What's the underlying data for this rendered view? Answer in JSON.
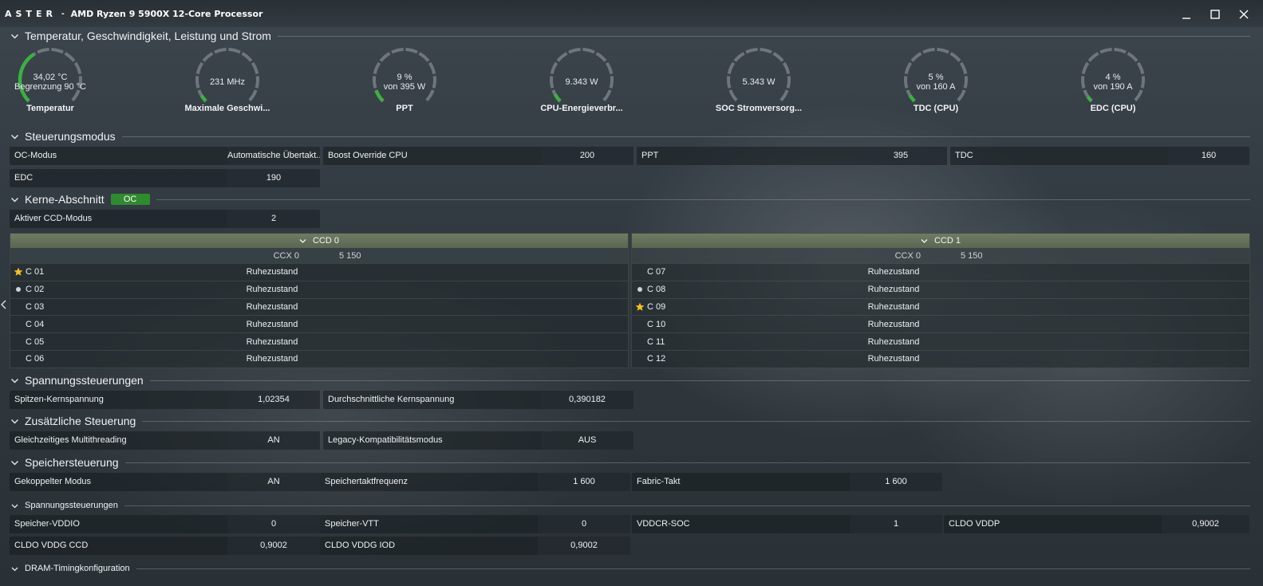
{
  "titlebar": {
    "brand": "ASTER",
    "separator": "-",
    "title": "AMD Ryzen 9 5900X 12-Core Processor"
  },
  "sections": {
    "temp": "Temperatur, Geschwindigkeit, Leistung und Strom",
    "control_mode": "Steuerungsmodus",
    "cores": "Kerne-Abschnitt",
    "cores_badge": "OC",
    "voltage": "Spannungssteuerungen",
    "extra": "Zusätzliche Steuerung",
    "memory": "Speichersteuerung",
    "mem_voltage": "Spannungssteuerungen",
    "dram_timing": "DRAM-Timingkonfiguration"
  },
  "gauges": [
    {
      "value": "34,02 °C",
      "sub": "Begrenzung 90 °C",
      "label": "Temperatur",
      "fill": 0.378
    },
    {
      "value": "231  MHz",
      "sub": "",
      "label": "Maximale Geschwi...",
      "fill": 0.05
    },
    {
      "value": "9 %",
      "sub": "von 395 W",
      "label": "PPT",
      "fill": 0.09
    },
    {
      "value": "9.343 W",
      "sub": "",
      "label": "CPU-Energieverbr...",
      "fill": 0.06
    },
    {
      "value": "5.343 W",
      "sub": "",
      "label": "SOC Stromversorg...",
      "fill": 0.0
    },
    {
      "value": "5 %",
      "sub": "von 160 A",
      "label": "TDC (CPU)",
      "fill": 0.05
    },
    {
      "value": "4 %",
      "sub": "von 190 A",
      "label": "EDC (CPU)",
      "fill": 0.04
    }
  ],
  "control": {
    "oc_mode": {
      "label": "OC-Modus",
      "value": "Automatische Übertakt..."
    },
    "boost": {
      "label": "Boost Override CPU",
      "value": "200"
    },
    "ppt": {
      "label": "PPT",
      "value": "395"
    },
    "tdc": {
      "label": "TDC",
      "value": "160"
    },
    "edc": {
      "label": "EDC",
      "value": "190"
    }
  },
  "cores": {
    "active_ccd": {
      "label": "Aktiver CCD-Modus",
      "value": "2"
    },
    "ccd0": {
      "title": "CCD 0",
      "ccx": "CCX 0",
      "freq": "5 150",
      "rows": [
        {
          "name": "C 01",
          "mark": "star",
          "state": "Ruhezustand"
        },
        {
          "name": "C 02",
          "mark": "dot",
          "state": "Ruhezustand"
        },
        {
          "name": "C 03",
          "mark": "",
          "state": "Ruhezustand"
        },
        {
          "name": "C 04",
          "mark": "",
          "state": "Ruhezustand"
        },
        {
          "name": "C 05",
          "mark": "",
          "state": "Ruhezustand"
        },
        {
          "name": "C 06",
          "mark": "",
          "state": "Ruhezustand"
        }
      ]
    },
    "ccd1": {
      "title": "CCD 1",
      "ccx": "CCX 0",
      "freq": "5 150",
      "rows": [
        {
          "name": "C 07",
          "mark": "",
          "state": "Ruhezustand"
        },
        {
          "name": "C 08",
          "mark": "dot",
          "state": "Ruhezustand"
        },
        {
          "name": "C 09",
          "mark": "star",
          "state": "Ruhezustand"
        },
        {
          "name": "C 10",
          "mark": "",
          "state": "Ruhezustand"
        },
        {
          "name": "C 11",
          "mark": "",
          "state": "Ruhezustand"
        },
        {
          "name": "C 12",
          "mark": "",
          "state": "Ruhezustand"
        }
      ]
    }
  },
  "voltage": {
    "peak": {
      "label": "Spitzen-Kernspannung",
      "value": "1,02354"
    },
    "avg": {
      "label": "Durchschnittliche Kernspannung",
      "value": "0,390182"
    }
  },
  "extra": {
    "smt": {
      "label": "Gleichzeitiges Multithreading",
      "value": "AN"
    },
    "legacy": {
      "label": "Legacy-Kompatibilitätsmodus",
      "value": "AUS"
    }
  },
  "memory": {
    "coupled": {
      "label": "Gekoppelter Modus",
      "value": "AN"
    },
    "memclk": {
      "label": "Speichertaktfrequenz",
      "value": "1 600"
    },
    "fabric": {
      "label": "Fabric-Takt",
      "value": "1 600"
    }
  },
  "mem_voltage": {
    "vddio": {
      "label": "Speicher-VDDIO",
      "value": "0"
    },
    "vtt": {
      "label": "Speicher-VTT",
      "value": "0"
    },
    "vddcr_soc": {
      "label": "VDDCR-SOC",
      "value": "1"
    },
    "cldo_vddp": {
      "label": "CLDO VDDP",
      "value": "0,9002"
    },
    "cldo_ccd": {
      "label": "CLDO VDDG CCD",
      "value": "0,9002"
    },
    "cldo_iod": {
      "label": "CLDO VDDG IOD",
      "value": "0,9002"
    }
  },
  "colors": {
    "accent_green": "#2e8b2e",
    "gauge_track": "#6e767c",
    "gauge_fill": "#3cb043",
    "ccd_header": "#6f7b63",
    "star": "#f2c21b"
  }
}
